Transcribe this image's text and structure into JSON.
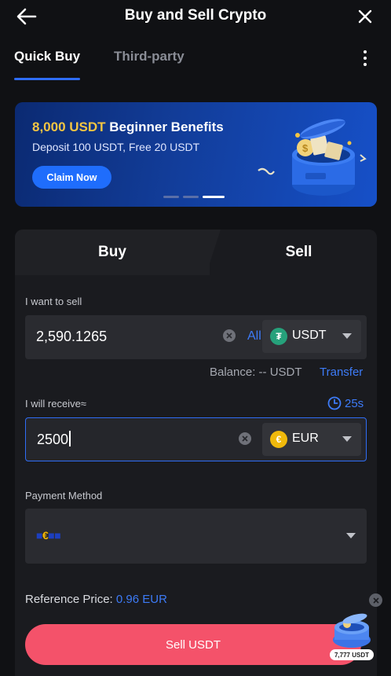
{
  "header": {
    "title": "Buy and Sell Crypto",
    "back_icon": "arrow-left-icon",
    "close_icon": "close-icon"
  },
  "tabs": [
    {
      "label": "Quick Buy",
      "active": true
    },
    {
      "label": "Third-party",
      "active": false
    }
  ],
  "banner": {
    "title_highlight": "8,000 USDT",
    "title_rest": " Beginner Benefits",
    "subtitle": "Deposit 100 USDT, Free 20 USDT",
    "cta": "Claim Now",
    "slides": 3,
    "active_slide": 3
  },
  "trade": {
    "segments": [
      "Buy",
      "Sell"
    ],
    "active_segment": "Sell",
    "sell_label": "I want to sell",
    "sell_amount": "2,590.1265",
    "all_label": "All",
    "sell_currency": "USDT",
    "balance_text": "Balance: -- USDT",
    "transfer_label": "Transfer",
    "receive_label": "I will receive≈",
    "countdown": "25s",
    "receive_amount": "2500",
    "receive_currency": "EUR",
    "payment_label": "Payment Method",
    "payment_value": "€",
    "reference_label": "Reference Price: ",
    "reference_value": "0.96 EUR",
    "submit_label": "Sell USDT"
  },
  "floating": {
    "badge": "7,777 USDT"
  },
  "colors": {
    "accent": "#2f6df6",
    "sell": "#f4526a",
    "usdt": "#26a17b",
    "eur": "#f0b90b",
    "background": "#101114"
  }
}
